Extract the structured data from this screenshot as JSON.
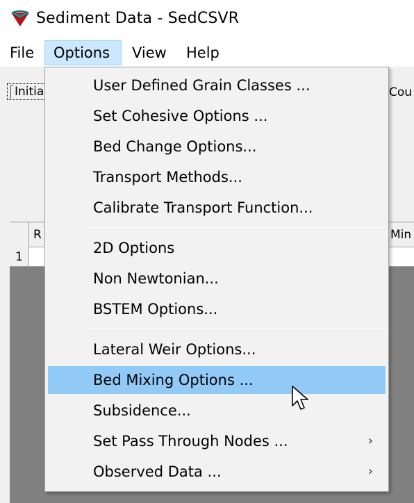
{
  "window": {
    "title": "Sediment Data - SedCSVR",
    "icon": "sedcsvr-app-icon"
  },
  "menubar": {
    "file": "File",
    "options": "Options",
    "view": "View",
    "help": "Help"
  },
  "background": {
    "tab_left_label": "Initia",
    "tab_right_label": "Cou",
    "grid_col1_header": "R",
    "grid_col_right_header": "Min",
    "grid_row1_label": "1"
  },
  "options_menu": {
    "items": [
      {
        "label": "User Defined Grain Classes ...",
        "submenu": false
      },
      {
        "label": "Set Cohesive Options ...",
        "submenu": false
      },
      {
        "label": "Bed Change Options...",
        "submenu": false
      },
      {
        "label": "Transport Methods...",
        "submenu": false
      },
      {
        "label": "Calibrate Transport Function...",
        "submenu": false
      },
      {
        "label": "2D Options",
        "submenu": false
      },
      {
        "label": "Non Newtonian...",
        "submenu": false
      },
      {
        "label": "BSTEM Options...",
        "submenu": false
      },
      {
        "label": "Lateral Weir Options...",
        "submenu": false
      },
      {
        "label": "Bed Mixing Options ...",
        "submenu": false,
        "highlighted": true
      },
      {
        "label": "Subsidence...",
        "submenu": false
      },
      {
        "label": "Set Pass Through Nodes ...",
        "submenu": true
      },
      {
        "label": "Observed Data ...",
        "submenu": true
      }
    ],
    "submenu_arrow": "›"
  },
  "colors": {
    "menu_highlight": "#91c9f7",
    "menubar_active": "#cce8ff",
    "grid_background": "#808080"
  }
}
